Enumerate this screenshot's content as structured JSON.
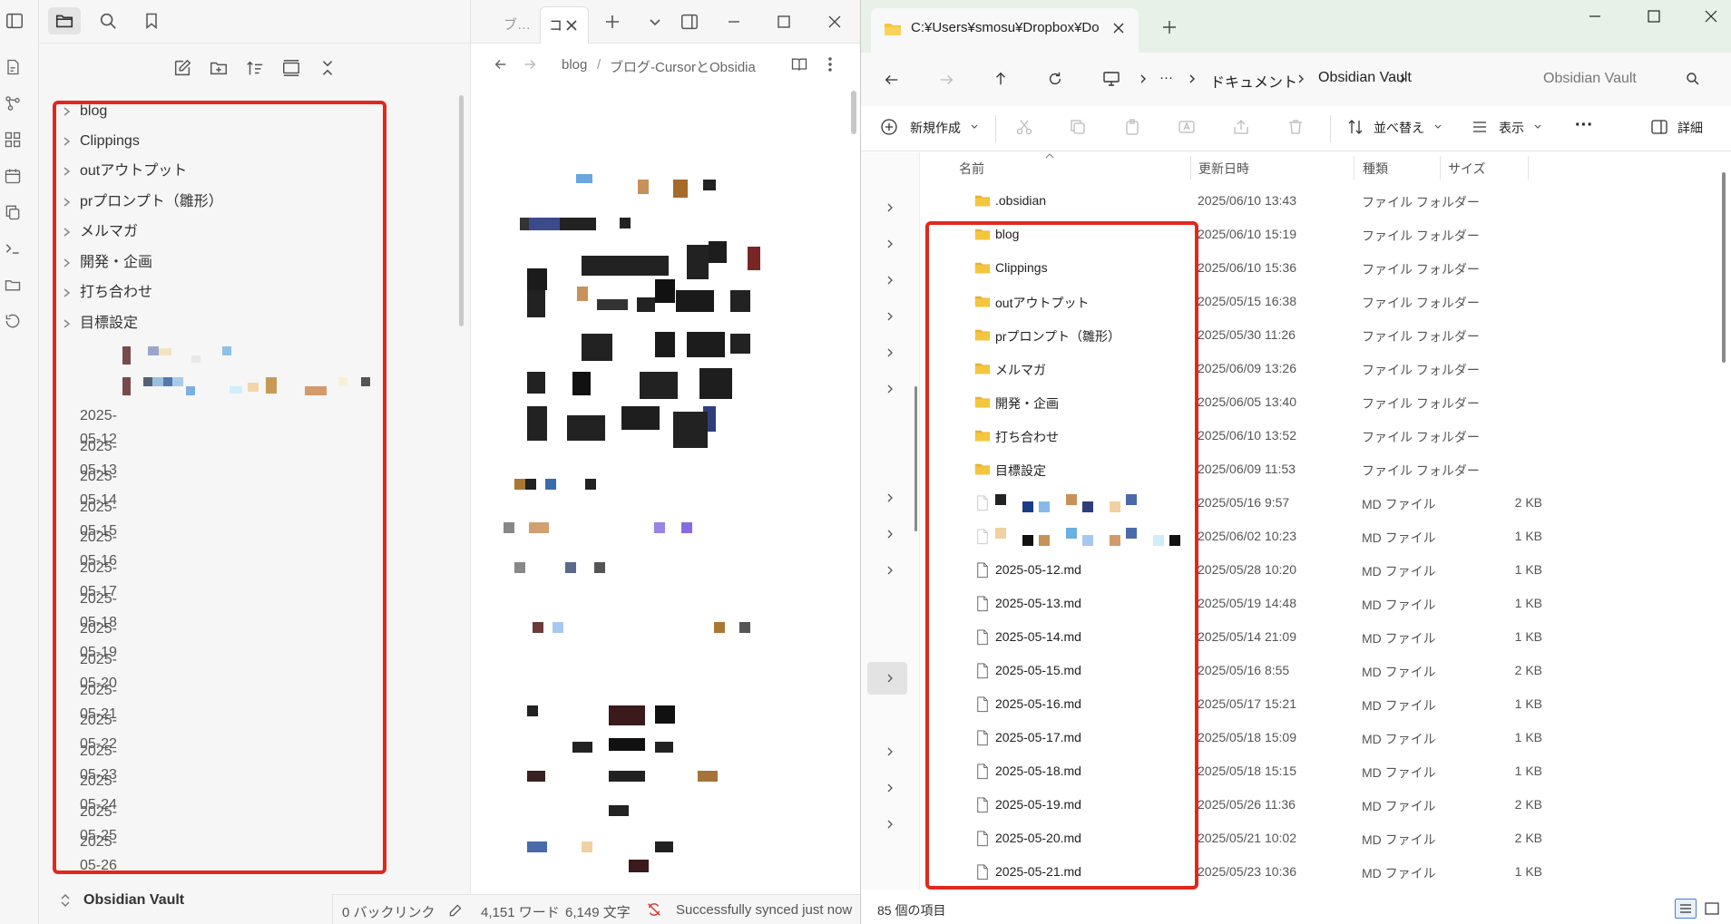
{
  "obsidian": {
    "tab_partial_label": "ブ…",
    "active_tab_label": "コ",
    "breadcrumb": {
      "folder": "blog",
      "sep": "/",
      "note": "ブログ-CursorとObsidia"
    },
    "file_tree": {
      "folders": [
        "blog",
        "Clippings",
        "outアウトプット",
        "prプロンプト（雛形）",
        "メルマガ",
        "開発・企画",
        "打ち合わせ",
        "目標設定"
      ],
      "files": [
        "2025-05-12",
        "2025-05-13",
        "2025-05-14",
        "2025-05-15",
        "2025-05-16",
        "2025-05-17",
        "2025-05-18",
        "2025-05-19",
        "2025-05-20",
        "2025-05-21",
        "2025-05-22",
        "2025-05-23",
        "2025-05-24",
        "2025-05-25",
        "2025-05-26"
      ]
    },
    "vault_name": "Obsidian Vault",
    "status": {
      "backlinks": "0 バックリンク",
      "words": "4,151 ワード",
      "chars": "6,149 文字",
      "sync": "Successfully synced just now"
    },
    "icons": [
      "sidebar-toggle-icon",
      "folder-icon",
      "search-icon",
      "bookmark-icon",
      "new-note-icon",
      "new-folder-icon",
      "sort-icon",
      "collapse-icon",
      "chevrons-icon",
      "plus-icon",
      "chevron-down-icon",
      "layout-icon",
      "minimize-icon",
      "maximize-icon",
      "close-icon",
      "back-icon",
      "forward-icon",
      "reading-view-icon",
      "more-icon",
      "sync-icon",
      "edit-icon"
    ],
    "accent_color": "#e0281d"
  },
  "explorer": {
    "tab_title": "C:¥Users¥smosu¥Dropbox¥Do",
    "breadcrumb": {
      "ellipsis": "···",
      "seg1": "ドキュメント",
      "seg2": "Obsidian Vault"
    },
    "search_placeholder": "Obsidian Vault",
    "toolbar": {
      "new": "新規作成",
      "sort": "並べ替え",
      "view": "表示",
      "more": "···",
      "details": "詳細"
    },
    "columns": {
      "name": "名前",
      "date": "更新日時",
      "type": "種類",
      "size": "サイズ"
    },
    "rows": [
      {
        "name": ".obsidian",
        "date": "2025/06/10 13:43",
        "type": "ファイル フォルダー",
        "size": "",
        "kind": "folder"
      },
      {
        "name": "blog",
        "date": "2025/06/10 15:19",
        "type": "ファイル フォルダー",
        "size": "",
        "kind": "folder"
      },
      {
        "name": "Clippings",
        "date": "2025/06/10 15:36",
        "type": "ファイル フォルダー",
        "size": "",
        "kind": "folder"
      },
      {
        "name": "outアウトプット",
        "date": "2025/05/15 16:38",
        "type": "ファイル フォルダー",
        "size": "",
        "kind": "folder"
      },
      {
        "name": "prプロンプト（雛形）",
        "date": "2025/05/30 11:26",
        "type": "ファイル フォルダー",
        "size": "",
        "kind": "folder"
      },
      {
        "name": "メルマガ",
        "date": "2025/06/09 13:26",
        "type": "ファイル フォルダー",
        "size": "",
        "kind": "folder"
      },
      {
        "name": "開発・企画",
        "date": "2025/06/05 13:40",
        "type": "ファイル フォルダー",
        "size": "",
        "kind": "folder"
      },
      {
        "name": "打ち合わせ",
        "date": "2025/06/10 13:52",
        "type": "ファイル フォルダー",
        "size": "",
        "kind": "folder"
      },
      {
        "name": "目標設定",
        "date": "2025/06/09 11:53",
        "type": "ファイル フォルダー",
        "size": "",
        "kind": "folder"
      },
      {
        "name": "",
        "date": "2025/05/16 9:57",
        "type": "MD ファイル",
        "size": "2 KB",
        "kind": "blurred"
      },
      {
        "name": "",
        "date": "2025/06/02 10:23",
        "type": "MD ファイル",
        "size": "1 KB",
        "kind": "blurred"
      },
      {
        "name": "2025-05-12.md",
        "date": "2025/05/28 10:20",
        "type": "MD ファイル",
        "size": "1 KB",
        "kind": "file"
      },
      {
        "name": "2025-05-13.md",
        "date": "2025/05/19 14:48",
        "type": "MD ファイル",
        "size": "1 KB",
        "kind": "file"
      },
      {
        "name": "2025-05-14.md",
        "date": "2025/05/14 21:09",
        "type": "MD ファイル",
        "size": "1 KB",
        "kind": "file"
      },
      {
        "name": "2025-05-15.md",
        "date": "2025/05/16 8:55",
        "type": "MD ファイル",
        "size": "2 KB",
        "kind": "file"
      },
      {
        "name": "2025-05-16.md",
        "date": "2025/05/17 15:21",
        "type": "MD ファイル",
        "size": "1 KB",
        "kind": "file"
      },
      {
        "name": "2025-05-17.md",
        "date": "2025/05/18 15:09",
        "type": "MD ファイル",
        "size": "1 KB",
        "kind": "file"
      },
      {
        "name": "2025-05-18.md",
        "date": "2025/05/18 15:15",
        "type": "MD ファイル",
        "size": "1 KB",
        "kind": "file"
      },
      {
        "name": "2025-05-19.md",
        "date": "2025/05/26 11:36",
        "type": "MD ファイル",
        "size": "2 KB",
        "kind": "file"
      },
      {
        "name": "2025-05-20.md",
        "date": "2025/05/21 10:02",
        "type": "MD ファイル",
        "size": "2 KB",
        "kind": "file"
      },
      {
        "name": "2025-05-21.md",
        "date": "2025/05/23 10:36",
        "type": "MD ファイル",
        "size": "1 KB",
        "kind": "file"
      }
    ],
    "item_count": "85 個の項目",
    "colors": {
      "titlebar": "#e7f1e7",
      "folder": "#f4c63d",
      "highlight": "#e0281d"
    }
  }
}
